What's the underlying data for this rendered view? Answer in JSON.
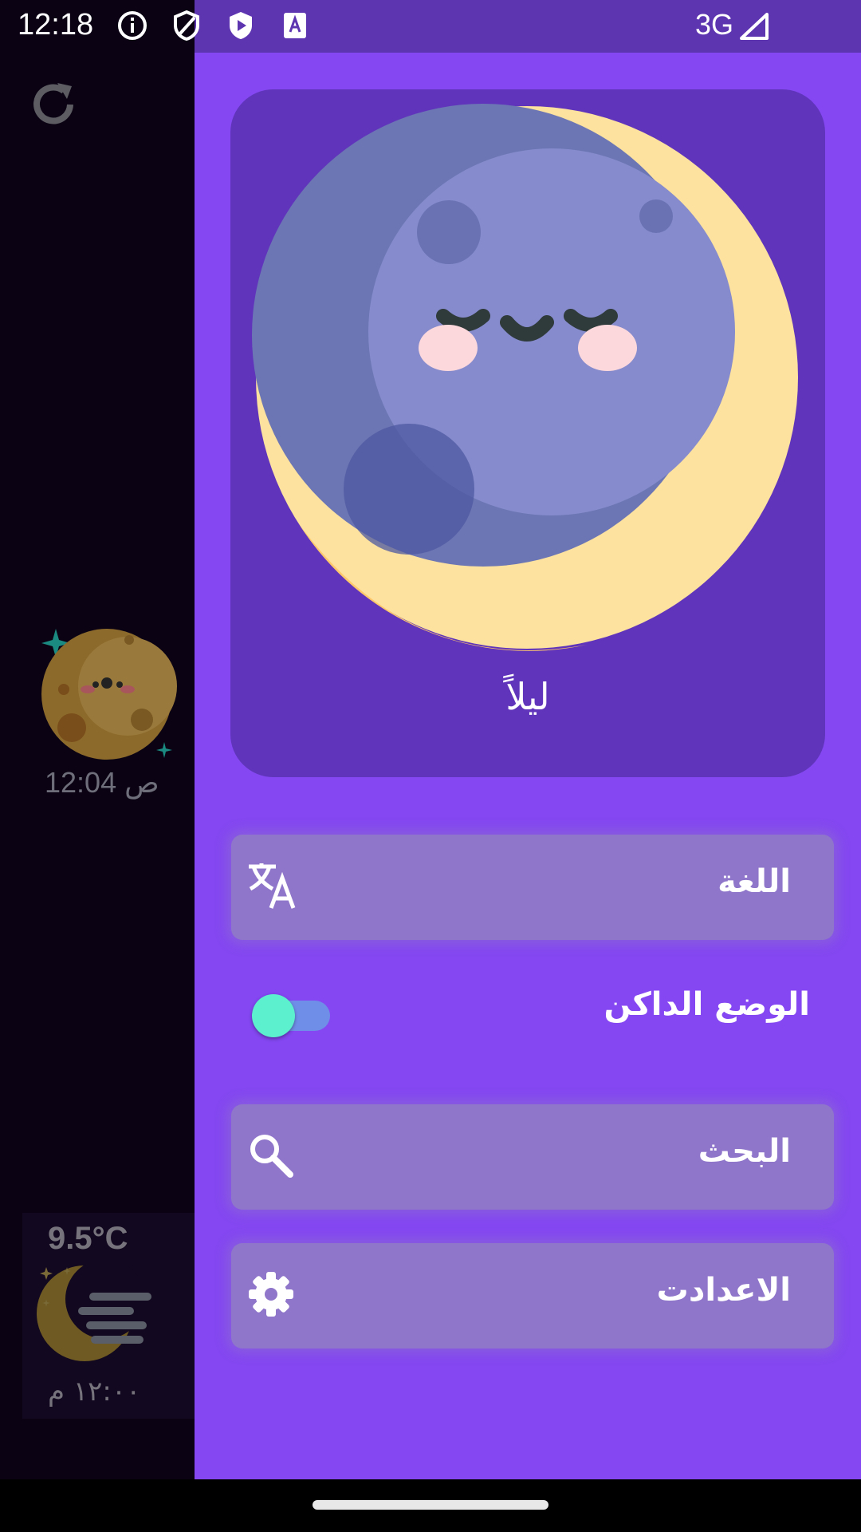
{
  "status_bar": {
    "time": "12:18",
    "network": "3G",
    "icons": [
      "info-icon",
      "shield-icon",
      "play-shield-icon",
      "text-a-icon",
      "signal-icon"
    ]
  },
  "background_app": {
    "icon": "refresh-icon",
    "mini_time": "12:04 ص",
    "weather": {
      "temperature": "9.5°C",
      "time": "١٢:٠٠ م",
      "icon": "moon-fog-icon"
    }
  },
  "drawer": {
    "hero": {
      "label": "ليلاً",
      "icon": "sleeping-moon-icon"
    },
    "menu": [
      {
        "label": "اللغة",
        "icon": "translate-icon"
      },
      {
        "label": "الوضع الداكن",
        "toggle_on": true
      },
      {
        "label": "البحث",
        "icon": "search-icon"
      },
      {
        "label": "الاعدادت",
        "icon": "gear-icon"
      }
    ]
  },
  "colors": {
    "drawer_bg": "#8447f1",
    "hero_card": "#6035bb",
    "menu_item": "#8f76ca",
    "toggle_thumb": "#5cf0cf",
    "toggle_track": "#6f8ee8"
  }
}
